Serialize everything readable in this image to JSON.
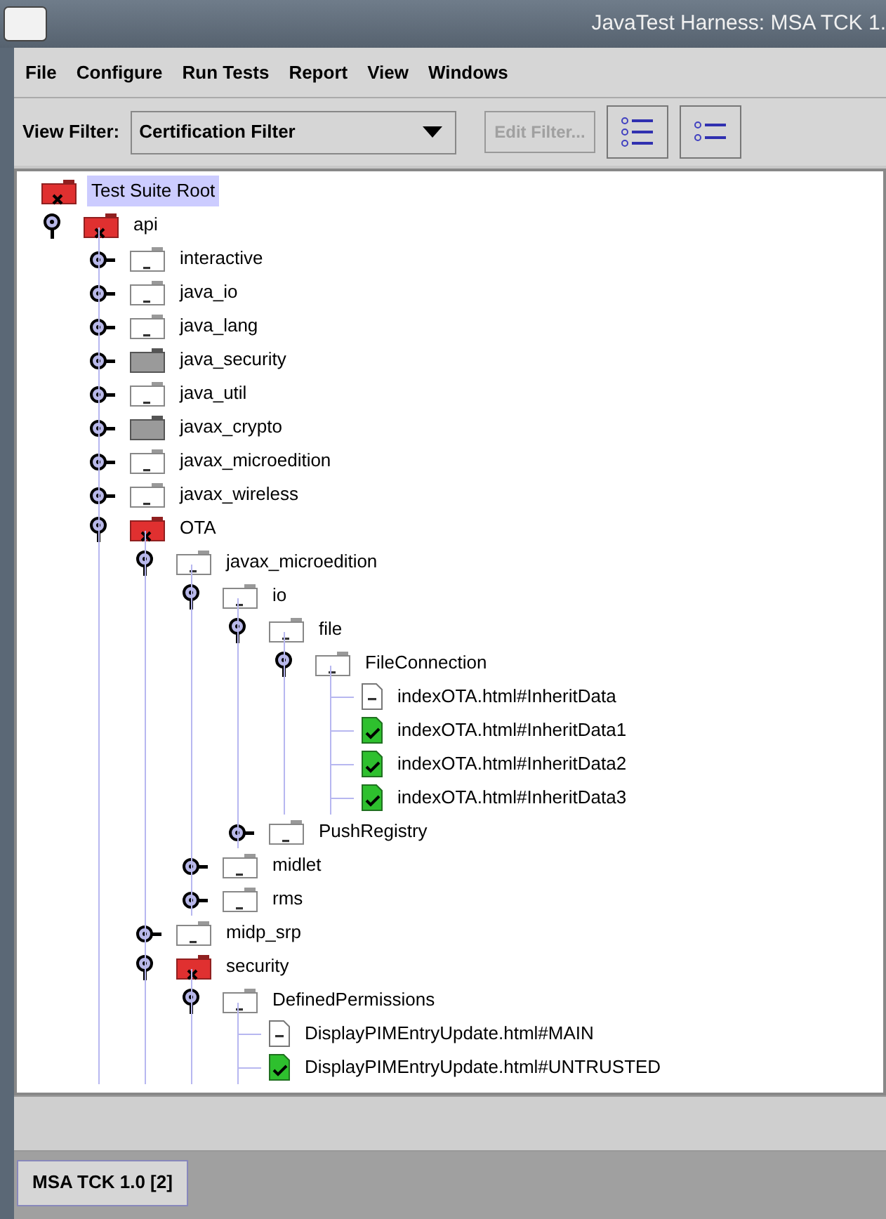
{
  "window": {
    "title": "JavaTest Harness: MSA TCK 1."
  },
  "menu": [
    "File",
    "Configure",
    "Run Tests",
    "Report",
    "View",
    "Windows"
  ],
  "toolbar": {
    "filter_label": "View Filter:",
    "filter_value": "Certification Filter",
    "edit_button": {
      "label": "Edit Filter...",
      "disabled": true
    }
  },
  "tree": {
    "label": "Test Suite Root",
    "kind": "failed_folder",
    "selected": true,
    "children": [
      {
        "label": "api",
        "kind": "failed_folder",
        "selected": false,
        "expanded": true,
        "children": [
          {
            "label": "interactive",
            "kind": "notrun_folder",
            "selected": false,
            "expanded": false
          },
          {
            "label": "java_io",
            "kind": "notrun_folder",
            "selected": false,
            "expanded": false
          },
          {
            "label": "java_lang",
            "kind": "notrun_folder",
            "selected": false,
            "expanded": false
          },
          {
            "label": "java_security",
            "kind": "filtered_folder",
            "selected": false,
            "expanded": false
          },
          {
            "label": "java_util",
            "kind": "notrun_folder",
            "selected": false,
            "expanded": false
          },
          {
            "label": "javax_crypto",
            "kind": "filtered_folder",
            "selected": false,
            "expanded": false
          },
          {
            "label": "javax_microedition",
            "kind": "notrun_folder",
            "selected": false,
            "expanded": false
          },
          {
            "label": "javax_wireless",
            "kind": "notrun_folder",
            "selected": false,
            "expanded": false
          },
          {
            "label": "OTA",
            "kind": "failed_folder",
            "selected": false,
            "expanded": true,
            "children": [
              {
                "label": "javax_microedition",
                "kind": "notrun_folder",
                "selected": false,
                "expanded": true,
                "children": [
                  {
                    "label": "io",
                    "kind": "notrun_folder",
                    "selected": false,
                    "expanded": true,
                    "children": [
                      {
                        "label": "file",
                        "kind": "notrun_folder",
                        "selected": false,
                        "expanded": true,
                        "children": [
                          {
                            "label": "FileConnection",
                            "kind": "notrun_folder",
                            "selected": false,
                            "expanded": true,
                            "children": [
                              {
                                "label": "indexOTA.html#InheritData",
                                "kind": "notrun_test",
                                "selected": false
                              },
                              {
                                "label": "indexOTA.html#InheritData1",
                                "kind": "passed_test",
                                "selected": false
                              },
                              {
                                "label": "indexOTA.html#InheritData2",
                                "kind": "passed_test",
                                "selected": false
                              },
                              {
                                "label": "indexOTA.html#InheritData3",
                                "kind": "passed_test",
                                "selected": false
                              }
                            ]
                          }
                        ]
                      },
                      {
                        "label": "PushRegistry",
                        "kind": "notrun_folder",
                        "selected": false,
                        "expanded": false
                      }
                    ]
                  },
                  {
                    "label": "midlet",
                    "kind": "notrun_folder",
                    "selected": false,
                    "expanded": false
                  },
                  {
                    "label": "rms",
                    "kind": "notrun_folder",
                    "selected": false,
                    "expanded": false
                  }
                ]
              },
              {
                "label": "midp_srp",
                "kind": "notrun_folder",
                "selected": false,
                "expanded": false
              },
              {
                "label": "security",
                "kind": "failed_folder",
                "selected": false,
                "expanded": true,
                "children": [
                  {
                    "label": "DefinedPermissions",
                    "kind": "notrun_folder",
                    "selected": false,
                    "expanded": true,
                    "children": [
                      {
                        "label": "DisplayPIMEntryUpdate.html#MAIN",
                        "kind": "notrun_test",
                        "selected": false
                      },
                      {
                        "label": "DisplayPIMEntryUpdate.html#UNTRUSTED",
                        "kind": "passed_test",
                        "selected": false
                      }
                    ]
                  }
                ]
              }
            ]
          }
        ]
      }
    ]
  },
  "tabs": [
    {
      "label": "MSA TCK 1.0 [2]",
      "selected": true
    }
  ]
}
